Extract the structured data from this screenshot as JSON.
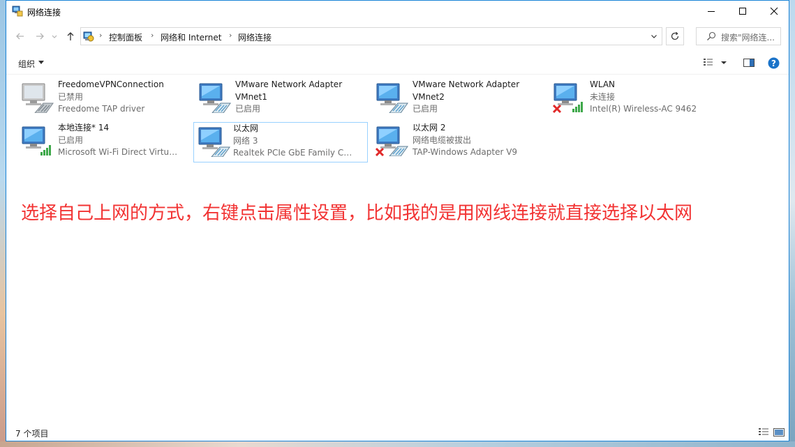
{
  "window": {
    "title": "网络连接"
  },
  "nav": {
    "back_icon": "back-arrow-icon",
    "forward_icon": "forward-arrow-icon",
    "recent_icon": "chevron-down-icon",
    "up_icon": "up-arrow-icon"
  },
  "address": {
    "crumbs": [
      "控制面板",
      "网络和 Internet",
      "网络连接"
    ]
  },
  "search": {
    "placeholder": "搜索\"网络连..."
  },
  "toolbar": {
    "organize_label": "组织"
  },
  "connections": [
    {
      "name": "FreedomeVPNConnection",
      "status": "已禁用",
      "device": "Freedome TAP driver",
      "badge": "none"
    },
    {
      "name": "VMware Network Adapter VMnet1",
      "name_line1": "VMware Network Adapter",
      "name_line2": "VMnet1",
      "status": "已启用",
      "badge": "none"
    },
    {
      "name": "VMware Network Adapter VMnet2",
      "name_line1": "VMware Network Adapter",
      "name_line2": "VMnet2",
      "status": "已启用",
      "badge": "none"
    },
    {
      "name": "WLAN",
      "status": "未连接",
      "device": "Intel(R) Wireless-AC 9462",
      "badge": "disconnected-wireless"
    },
    {
      "name": "本地连接* 14",
      "status": "已启用",
      "device": "Microsoft Wi-Fi Direct Virtual ...",
      "badge": "wireless"
    },
    {
      "name": "以太网",
      "status": "网络 3",
      "device": "Realtek PCIe GbE Family Contr...",
      "badge": "none",
      "selected": true
    },
    {
      "name": "以太网 2",
      "status": "网络电缆被拔出",
      "device": "TAP-Windows Adapter V9",
      "badge": "disconnected-cable"
    }
  ],
  "annotation": "选择自己上网的方式，右键点击属性设置，比如我的是用网线连接就直接选择以太网",
  "status_bar": {
    "item_count": "7 个项目"
  },
  "colors": {
    "accent": "#1883d7",
    "selection_border": "#99d1ff",
    "annotation_red": "#f23333",
    "link_help": "#1a73c9"
  }
}
